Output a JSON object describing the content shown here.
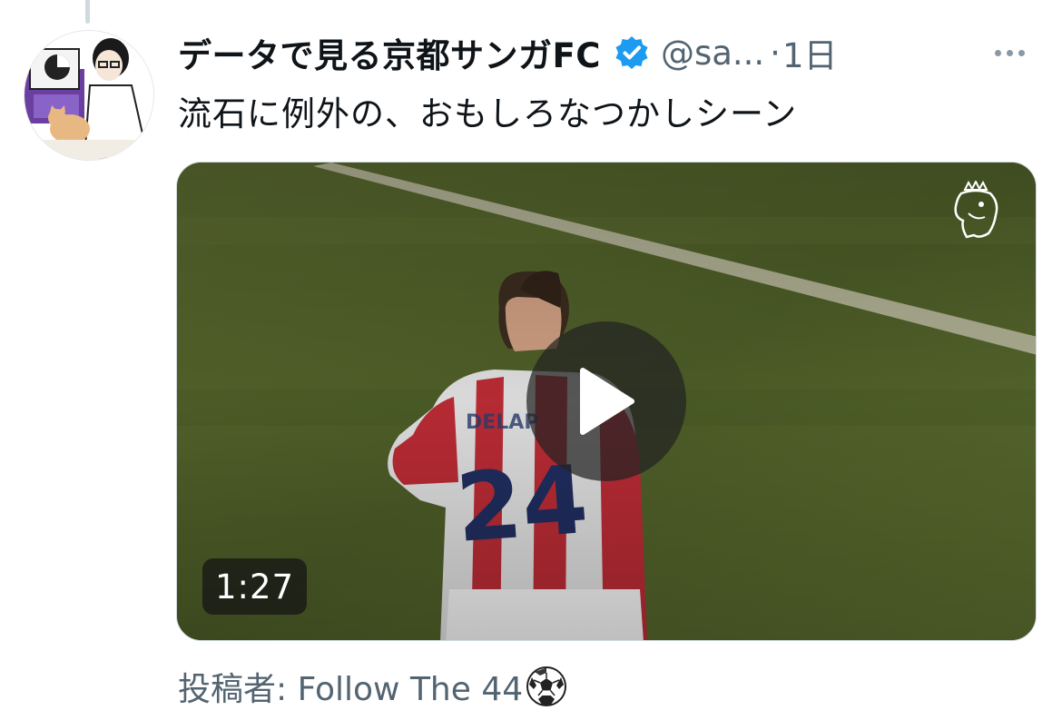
{
  "tweet": {
    "author_name": "データで見る京都サンガFC",
    "handle": "@sa...",
    "separator": "·",
    "timestamp": "1日",
    "verified": true,
    "text": "流石に例外の、おもしろなつかしシーン"
  },
  "media": {
    "type": "video",
    "duration": "1:27",
    "overlay_logo": "premier-league-lion-logo",
    "play_icon": "play-icon"
  },
  "attribution": {
    "text": "投稿者: Follow The 44",
    "emoji": "soccer-ball-icon"
  },
  "colors": {
    "verified_blue": "#1d9bf0",
    "secondary_text": "#536471",
    "pitch_green": "#4b5826"
  }
}
